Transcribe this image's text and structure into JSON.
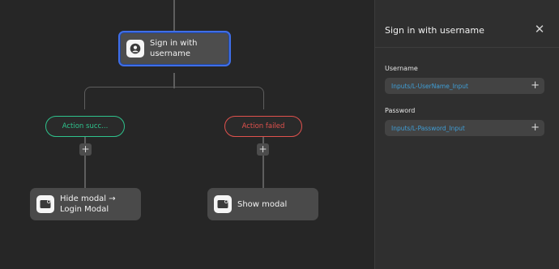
{
  "flow": {
    "main_node": {
      "label": "Sign in with username",
      "icon": "user-avatar-icon"
    },
    "success_branch": {
      "label": "Action succ...",
      "color": "#2ec28c",
      "add_label": "+"
    },
    "failed_branch": {
      "label": "Action failed",
      "color": "#e0514d",
      "add_label": "+"
    },
    "success_node": {
      "label": "Hide modal → Login Modal",
      "icon": "modal-icon"
    },
    "failed_node": {
      "label": "Show modal",
      "icon": "modal-icon"
    }
  },
  "panel": {
    "title": "Sign in with username",
    "close_icon": "close-icon",
    "fields": [
      {
        "label": "Username",
        "value": "Inputs/L-UserName_Input",
        "add_label": "+"
      },
      {
        "label": "Password",
        "value": "Inputs/L-Password_Input",
        "add_label": "+"
      }
    ]
  },
  "colors": {
    "selection": "#3f6ee8",
    "link": "#3f9ed6",
    "canvas": "#262626",
    "panel": "#2f2f2f"
  }
}
